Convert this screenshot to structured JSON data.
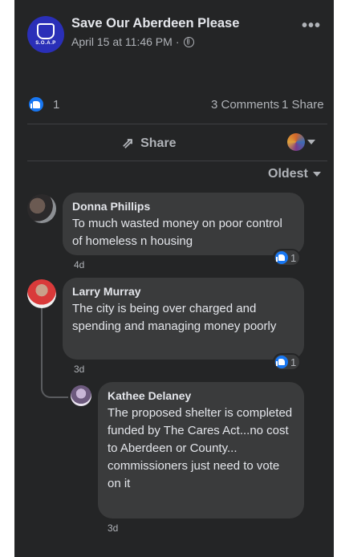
{
  "post": {
    "page_name": "Save Our Aberdeen Please",
    "timestamp": "April 15 at 11:46 PM",
    "meta_separator": "·",
    "logo_text": "S.O.A.P",
    "more_label": "•••"
  },
  "reactions": {
    "count": "1",
    "type": "like"
  },
  "stats": {
    "comments": "3 Comments",
    "shares": "1 Share"
  },
  "actions": {
    "share_label": "Share"
  },
  "sort": {
    "label": "Oldest"
  },
  "comments": [
    {
      "name": "Donna Phillips",
      "text": "To much wasted money on poor control of homeless n housing",
      "time": "4d",
      "likes": "1"
    },
    {
      "name": "Larry Murray",
      "text": "The city is being over charged and spending and managing money poorly",
      "time": "3d",
      "likes": "1",
      "reply": {
        "name": "Kathee Delaney",
        "text": "The proposed shelter is completed funded by The Cares Act...no cost to Aberdeen or County... commissioners just need to vote on it",
        "time": "3d"
      }
    }
  ],
  "colors": {
    "panel_bg": "#242526",
    "bubble_bg": "#3a3b3c",
    "accent_blue": "#1877f2",
    "text_primary": "#e4e6eb",
    "text_secondary": "#b0b3b8"
  }
}
